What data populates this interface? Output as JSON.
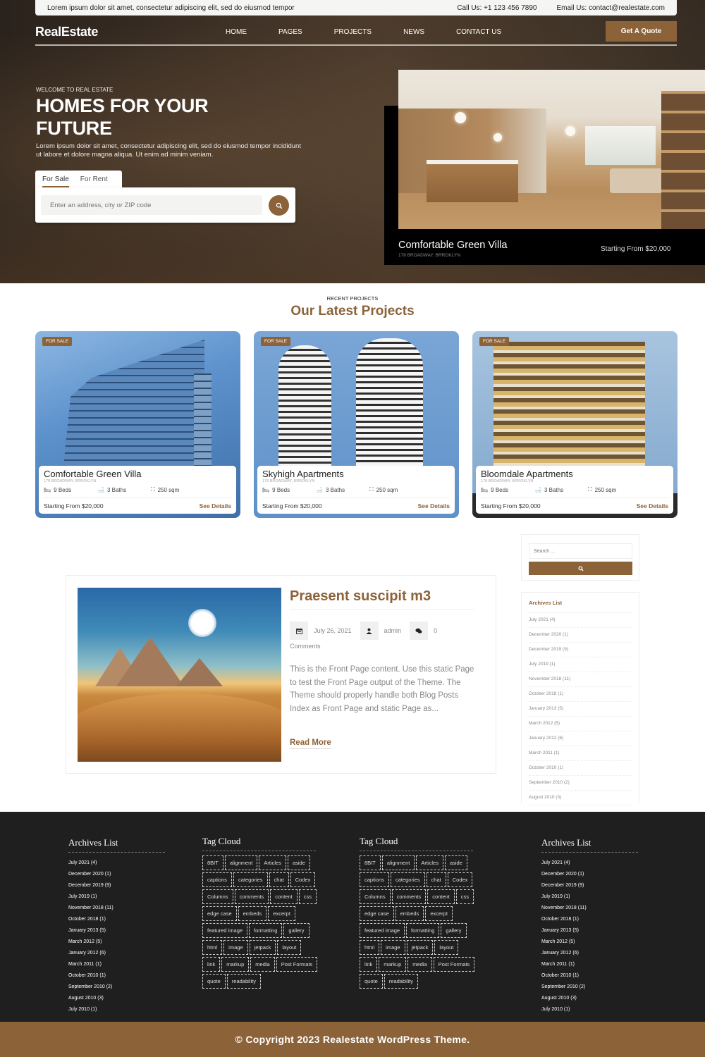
{
  "topbar": {
    "tagline": "Lorem ipsum dolor sit amet, consectetur adipiscing elit, sed do eiusmod tempor",
    "phone": "Call Us: +1 123 456 7890",
    "email": "Email Us: contact@realestate.com"
  },
  "header": {
    "logo": "RealEstate",
    "menu": [
      "HOME",
      "PAGES",
      "PROJECTS",
      "NEWS",
      "CONTACT US"
    ],
    "cta": "Get A Quote"
  },
  "hero": {
    "eyebrow": "WELCOME TO REAL ESTATE",
    "headline": "HOMES FOR YOUR FUTURE",
    "text": "Lorem ipsum dolor sit amet, consectetur adipiscing elit, sed do eiusmod tempor incididunt ut labore et dolore magna aliqua. Ut enim ad minim veniam.",
    "tabs": [
      "For Sale",
      "For Rent"
    ],
    "active_tab": "For Sale",
    "search_placeholder": "Enter an address, city or ZIP code",
    "featured": {
      "title": "Comfortable Green Villa",
      "address": "178 BROADWAY, BRROKLYN",
      "price": "Starting From $20,000"
    }
  },
  "projects": {
    "subtitle": "RECENT PROJECTS",
    "title": "Our Latest Projects",
    "items": [
      {
        "badge": "FOR SALE",
        "title": "Comfortable Green Villa",
        "address": "178 BROADWAY, BRROKLYN",
        "beds": "9 Beds",
        "baths": "3 Baths",
        "area": "250 sqm",
        "price": "Starting From $20,000",
        "link": "See Details"
      },
      {
        "badge": "FOR SALE",
        "title": "Skyhigh Apartments",
        "address": "178 BROADWAY, BRROKLYN",
        "beds": "9 Beds",
        "baths": "3 Baths",
        "area": "250 sqm",
        "price": "Starting From $20,000",
        "link": "See Details"
      },
      {
        "badge": "FOR SALE",
        "title": "Bloomdale Apartments",
        "address": "178 BROADWAY, BRROKLYN",
        "beds": "9 Beds",
        "baths": "3 Baths",
        "area": "250 sqm",
        "price": "Starting From $20,000",
        "link": "See Details"
      }
    ]
  },
  "post": {
    "title": "Praesent suscipit m3",
    "date": "July 26, 2021",
    "author": "admin",
    "comments_count": "0",
    "comments_label": "Comments",
    "excerpt": "This is the Front Page content. Use this static Page to test the Front Page output of the Theme. The Theme should properly handle both Blog Posts Index as Front Page and static Page as...",
    "read_more": "Read More"
  },
  "sidebar": {
    "search_placeholder": "Search ...",
    "archives_title": "Archives List",
    "archives": [
      "July 2021 (4)",
      "December 2020 (1)",
      "December 2019 (9)",
      "July 2019 (1)",
      "November 2018 (11)",
      "October 2018 (1)",
      "January 2013 (5)",
      "March 2012 (5)",
      "January 2012 (6)",
      "March 2011 (1)",
      "October 2010 (1)",
      "September 2010 (2)",
      "August 2010 (3)"
    ]
  },
  "footer": {
    "archives_title": "Archives List",
    "archives": [
      "July 2021 (4)",
      "December 2020 (1)",
      "December 2019 (9)",
      "July 2019 (1)",
      "November 2018 (11)",
      "October 2018 (1)",
      "January 2013 (5)",
      "March 2012 (5)",
      "January 2012 (6)",
      "March 2011 (1)",
      "October 2010 (1)",
      "September 2010 (2)",
      "August 2010 (3)",
      "July 2010 (1)"
    ],
    "tags_title": "Tag Cloud",
    "tags": [
      "8BIT",
      "alignment",
      "Articles",
      "aside",
      "captions",
      "categories",
      "chat",
      "Codex",
      "Columns",
      "comments",
      "content",
      "css",
      "edge case",
      "embeds",
      "excerpt",
      "featured image",
      "formatting",
      "gallery",
      "html",
      "image",
      "jetpack",
      "layout",
      "link",
      "markup",
      "media",
      "Post Formats",
      "quote",
      "readability"
    ],
    "copyright": "© Copyright 2023 Realestate WordPress Theme."
  },
  "colors": {
    "accent": "#8c6239",
    "footer_bg": "#1f1f20"
  }
}
